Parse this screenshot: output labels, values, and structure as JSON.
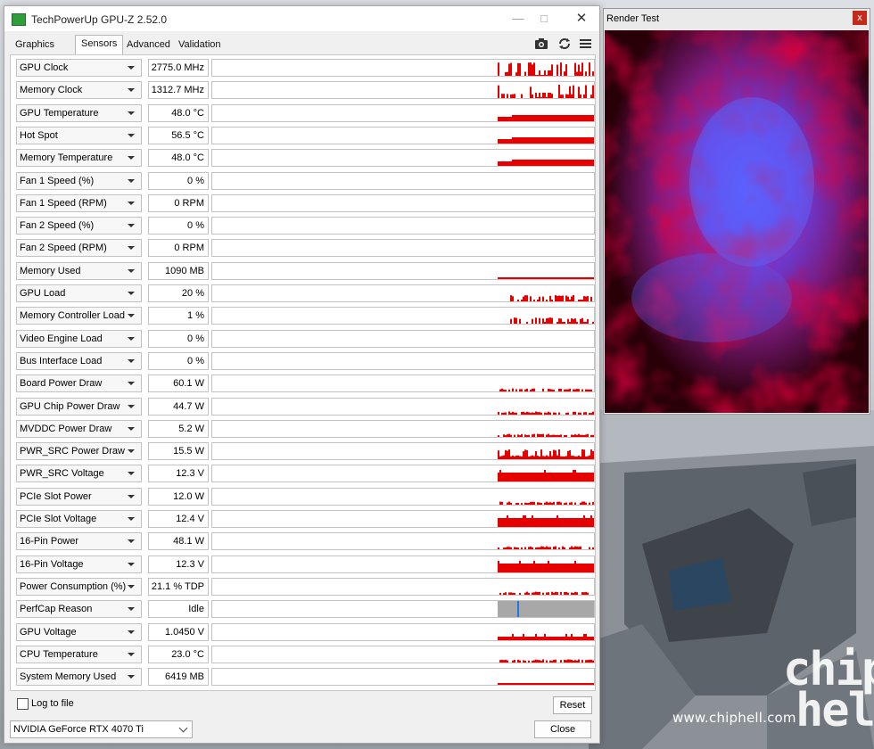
{
  "window": {
    "title": "TechPowerUp GPU-Z 2.52.0",
    "tabs": [
      "Graphics Card",
      "Sensors",
      "Advanced",
      "Validation"
    ],
    "active_tab": "Sensors"
  },
  "sensors": [
    {
      "name": "GPU Clock",
      "value": "2775.0 MHz",
      "graph": "spiky-tall"
    },
    {
      "name": "Memory Clock",
      "value": "1312.7 MHz",
      "graph": "spiky-tall"
    },
    {
      "name": "GPU Temperature",
      "value": "48.0 °C",
      "graph": "band"
    },
    {
      "name": "Hot Spot",
      "value": "56.5 °C",
      "graph": "band"
    },
    {
      "name": "Memory Temperature",
      "value": "48.0 °C",
      "graph": "band"
    },
    {
      "name": "Fan 1 Speed (%)",
      "value": "0 %",
      "graph": "none"
    },
    {
      "name": "Fan 1 Speed (RPM)",
      "value": "0 RPM",
      "graph": "none"
    },
    {
      "name": "Fan 2 Speed (%)",
      "value": "0 %",
      "graph": "none"
    },
    {
      "name": "Fan 2 Speed (RPM)",
      "value": "0 RPM",
      "graph": "none"
    },
    {
      "name": "Memory Used",
      "value": "1090 MB",
      "graph": "line"
    },
    {
      "name": "GPU Load",
      "value": "20 %",
      "graph": "sparse"
    },
    {
      "name": "Memory Controller Load",
      "value": "1 %",
      "graph": "sparse"
    },
    {
      "name": "Video Engine Load",
      "value": "0 %",
      "graph": "none"
    },
    {
      "name": "Bus Interface Load",
      "value": "0 %",
      "graph": "none"
    },
    {
      "name": "Board Power Draw",
      "value": "60.1 W",
      "graph": "low"
    },
    {
      "name": "GPU Chip Power Draw",
      "value": "44.7 W",
      "graph": "low"
    },
    {
      "name": "MVDDC Power Draw",
      "value": "5.2 W",
      "graph": "low"
    },
    {
      "name": "PWR_SRC Power Draw",
      "value": "15.5 W",
      "graph": "spiky-mid"
    },
    {
      "name": "PWR_SRC Voltage",
      "value": "12.3 V",
      "graph": "block"
    },
    {
      "name": "PCIe Slot Power",
      "value": "12.0 W",
      "graph": "low"
    },
    {
      "name": "PCIe Slot Voltage",
      "value": "12.4 V",
      "graph": "block"
    },
    {
      "name": "16-Pin Power",
      "value": "48.1 W",
      "graph": "low"
    },
    {
      "name": "16-Pin Voltage",
      "value": "12.3 V",
      "graph": "block"
    },
    {
      "name": "Power Consumption (%)",
      "value": "21.1 % TDP",
      "graph": "low"
    },
    {
      "name": "PerfCap Reason",
      "value": "Idle",
      "graph": "perfcap"
    },
    {
      "name": "GPU Voltage",
      "value": "1.0450 V",
      "graph": "band-low"
    },
    {
      "name": "CPU Temperature",
      "value": "23.0 °C",
      "graph": "low"
    },
    {
      "name": "System Memory Used",
      "value": "6419 MB",
      "graph": "line"
    }
  ],
  "bottom": {
    "log_label": "Log to file",
    "reset_label": "Reset",
    "gpu_selected": "NVIDIA GeForce RTX 4070 Ti",
    "close_label": "Close"
  },
  "render_test": {
    "title": "Render Test",
    "close_glyph": "x"
  },
  "wallpaper": {
    "watermark_logo": "chip hell",
    "watermark_url": "www.chiphell.com"
  },
  "colors": {
    "graph": "#e60000",
    "perfcap_idle": "#a8a8a8",
    "perfcap_marker": "#1f7ae0"
  }
}
